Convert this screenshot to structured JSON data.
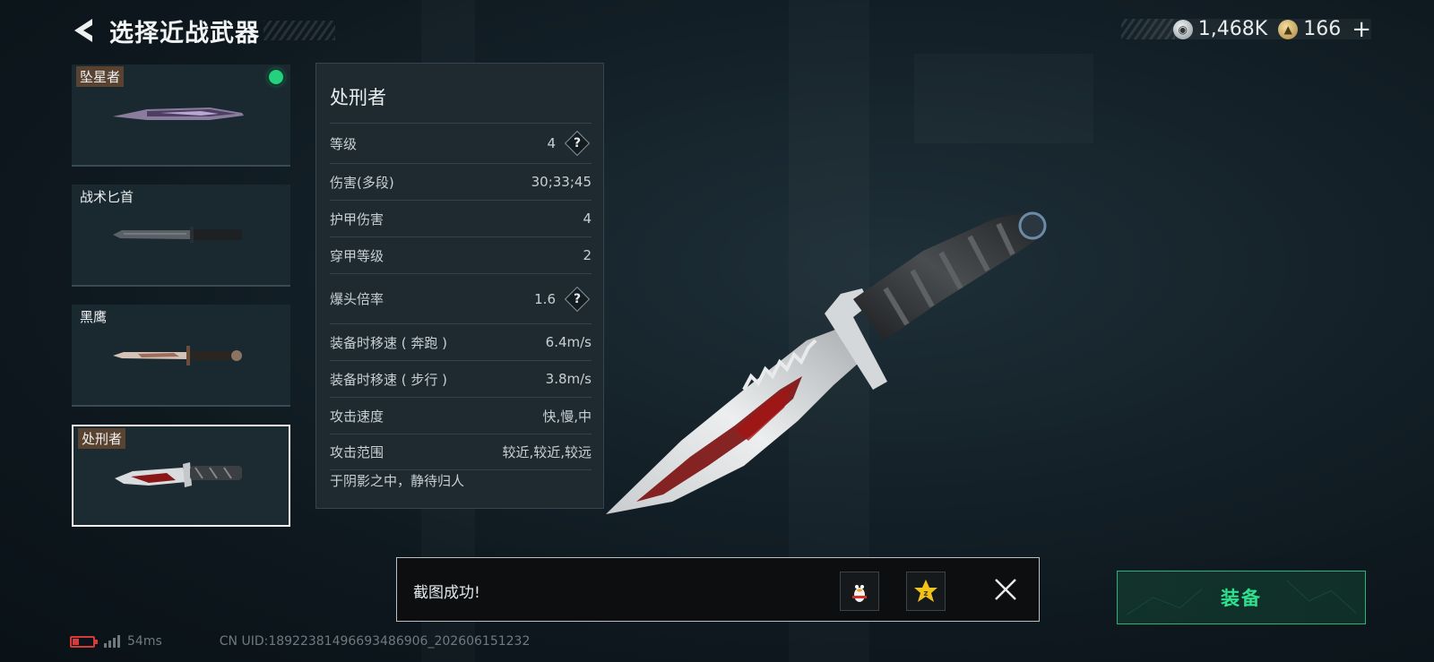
{
  "header": {
    "title": "选择近战武器"
  },
  "currency": {
    "silver_amount": "1,468K",
    "gold_amount": "166",
    "add_label": "+"
  },
  "weapons": [
    {
      "name": "坠星者",
      "equipped": true
    },
    {
      "name": "战术匕首",
      "equipped": false
    },
    {
      "name": "黑鹰",
      "equipped": false
    },
    {
      "name": "处刑者",
      "equipped": false,
      "selected": true
    }
  ],
  "detail": {
    "name": "处刑者",
    "stats": [
      {
        "label": "等级",
        "value": "4",
        "help": "?"
      },
      {
        "label": "伤害(多段)",
        "value": "30;33;45"
      },
      {
        "label": "护甲伤害",
        "value": "4"
      },
      {
        "label": "穿甲等级",
        "value": "2"
      },
      {
        "label": "爆头倍率",
        "value": "1.6",
        "help": "?"
      },
      {
        "label": "装备时移速 ( 奔跑 )",
        "value": "6.4m/s"
      },
      {
        "label": "装备时移速 ( 步行 )",
        "value": "3.8m/s"
      },
      {
        "label": "攻击速度",
        "value": "快,慢,中"
      },
      {
        "label": "攻击范围",
        "value": "较近,较近,较远"
      }
    ],
    "description": "于阴影之中，静待归人"
  },
  "toast": {
    "message": "截图成功!"
  },
  "equip": {
    "label": "装备"
  },
  "status": {
    "battery_percent": 30,
    "ping": "54ms",
    "uid": "CN UID:18922381496693486906_202606151232"
  },
  "colors": {
    "accent_green": "#2fe08f",
    "equipped_dot": "#25d07e",
    "battery_low": "#d53b3b"
  }
}
